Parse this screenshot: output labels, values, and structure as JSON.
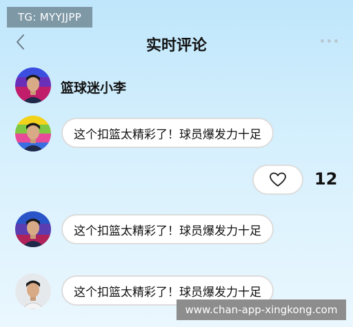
{
  "overlay": {
    "tg_label": "TG: MYYJJPP",
    "watermark": "www.chan-app-xingkong.com"
  },
  "header": {
    "title": "实时评论",
    "back_icon": "chevron-left-icon",
    "more_icon": "more-dots-icon"
  },
  "author": {
    "username": "篮球迷小李"
  },
  "comments": [
    {
      "text": "这个扣篮太精彩了！球员爆发力十足"
    },
    {
      "text": "这个扣篮太精彩了！球员爆发力十足"
    },
    {
      "text": "这个扣篮太精彩了！球员爆发力十足"
    }
  ],
  "like": {
    "icon": "heart-icon",
    "count": "12"
  },
  "colors": {
    "background_top": "#bfe6fb",
    "background_bottom": "#eaf7fe",
    "badge": "#7e98a6",
    "watermark_bg": "#8d8d8d"
  }
}
